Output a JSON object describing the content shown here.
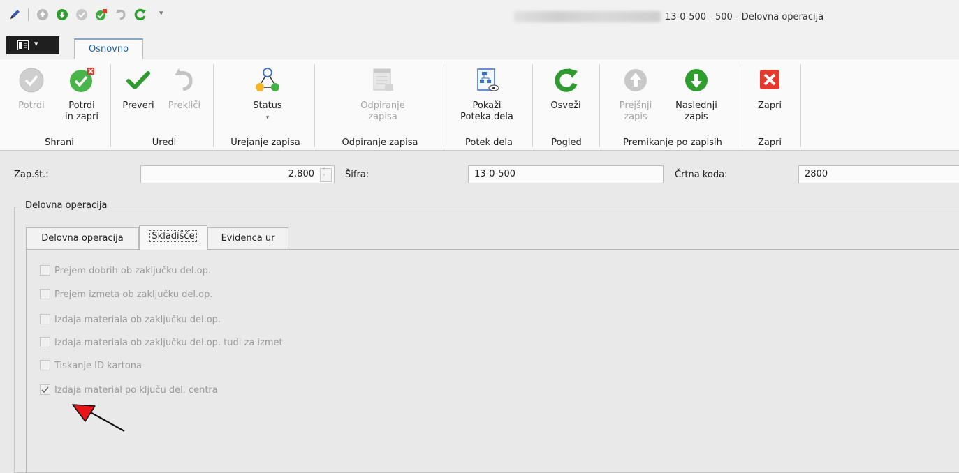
{
  "window": {
    "title": "13-0-500 - 500 - Delovna operacija"
  },
  "tabs": {
    "main": "Osnovno"
  },
  "ribbon": {
    "potrdi": "Potrdi",
    "potrdi_zapri_1": "Potrdi",
    "potrdi_zapri_2": "in zapri",
    "preveri": "Preveri",
    "preklici": "Prekliči",
    "status": "Status",
    "odpiranje_1": "Odpiranje",
    "odpiranje_2": "zapisa",
    "pokazi_1": "Pokaži",
    "pokazi_2": "Poteka dela",
    "osvezi": "Osveži",
    "prejsnji_1": "Prejšnji",
    "prejsnji_2": "zapis",
    "naslednji_1": "Naslednji",
    "naslednji_2": "zapis",
    "zapri": "Zapri",
    "groups": {
      "shrani": "Shrani",
      "uredi": "Uredi",
      "urejanje": "Urejanje zapisa",
      "odpiranje": "Odpiranje zapisa",
      "potek": "Potek dela",
      "pogled": "Pogled",
      "premikanje": "Premikanje po zapisih",
      "zapri": "Zapri"
    }
  },
  "fields": {
    "zap_st_label": "Zap.št.:",
    "zap_st_value": "2.800",
    "sifra_label": "Šifra:",
    "sifra_value": "13-0-500",
    "crtna_label": "Črtna koda:",
    "crtna_value": "2800"
  },
  "groupbox": {
    "title": "Delovna operacija",
    "tabs": [
      "Delovna operacija",
      "Skladišče",
      "Evidenca ur"
    ],
    "checkboxes": [
      {
        "label": "Prejem dobrih ob zaključku del.op.",
        "checked": false
      },
      {
        "label": "Prejem izmeta ob zaključku del.op.",
        "checked": false
      },
      {
        "label": "Izdaja materiala ob zaključku del.op.",
        "checked": false
      },
      {
        "label": "Izdaja materiala ob zaključku del.op. tudi za izmet",
        "checked": false
      },
      {
        "label": "Tiskanje ID kartona",
        "checked": false
      },
      {
        "label": "Izdaja material po ključu del. centra",
        "checked": true
      }
    ]
  },
  "colors": {
    "accent_blue": "#1e5fa8",
    "check_green": "#2f9a2f",
    "close_red": "#e23a2e",
    "arrow_red": "#e8141a"
  }
}
